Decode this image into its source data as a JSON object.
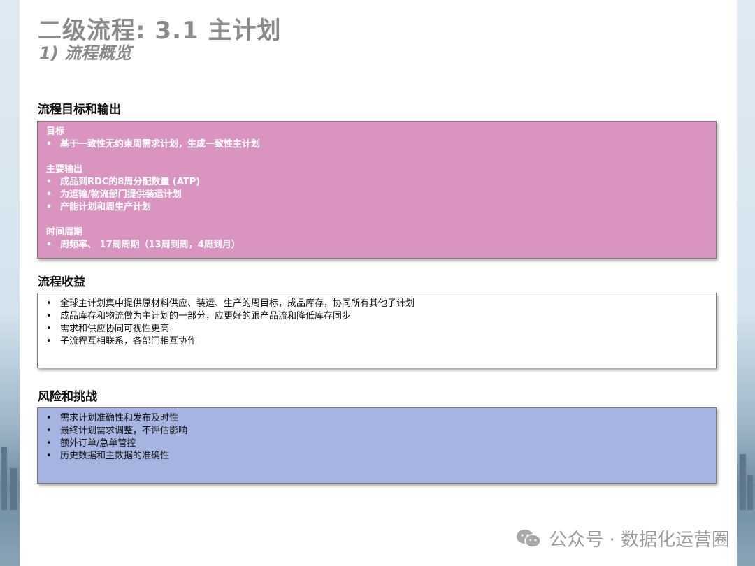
{
  "title": "二级流程: 3.1 主计划",
  "subtitle": "1) 流程概览",
  "section1": {
    "heading": "流程目标和输出",
    "groups": [
      {
        "head": "目标",
        "items": [
          "基于一致性无约束周需求计划，生成一致性主计划"
        ]
      },
      {
        "head": "主要输出",
        "items": [
          "成品到RDC的8周分配数量 (ATP)",
          "为运输/物流部门提供装运计划",
          "产能计划和周生产计划"
        ]
      },
      {
        "head": "时间周期",
        "items": [
          "周频率、 17周周期（13周到周，4周到月）"
        ]
      }
    ]
  },
  "section2": {
    "heading": "流程收益",
    "items": [
      "全球主计划集中提供原材料供应、装运、生产的周目标，成品库存，协同所有其他子计划",
      "成品库存和物流做为主计划的一部分，应更好的跟产品流和降低库存同步",
      "需求和供应协同可视性更高",
      "子流程互相联系，各部门相互协作"
    ]
  },
  "section3": {
    "heading": "风险和挑战",
    "items": [
      "需求计划准确性和发布及时性",
      "最终计划需求调整，不评估影响",
      "额外订单/急单管控",
      "历史数据和主数据的准确性"
    ]
  },
  "watermark": {
    "text": "公众号 · 数据化运营圈",
    "icon": "wechat-icon"
  },
  "colors": {
    "pink": "#d994c0",
    "blue": "#a5b4e0",
    "title": "#8a8a8a"
  }
}
